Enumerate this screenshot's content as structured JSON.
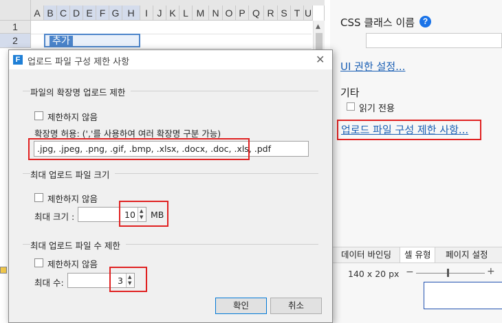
{
  "sheet": {
    "columns": [
      "A",
      "B",
      "C",
      "D",
      "E",
      "F",
      "G",
      "H",
      "I",
      "J",
      "K",
      "L",
      "M",
      "N",
      "O",
      "P",
      "Q",
      "R",
      "S",
      "T",
      "U"
    ],
    "rows": [
      "1",
      "2"
    ],
    "cell_text": "추가"
  },
  "panel": {
    "css_class_label": "CSS 클래스 이름",
    "help_icon": "?",
    "ui_permission_link": "UI 권한 설정...",
    "etc_label": "기타",
    "readonly_label": "읽기 전용",
    "upload_restriction_link": "업로드 파일 구성 제한 사항...",
    "tabs": [
      "데이터 바인딩",
      "셀 유형",
      "페이지 설정"
    ],
    "active_tab": "셀 유형",
    "size_text": "140 x 20 px",
    "zoom_minus": "−",
    "zoom_plus": "+"
  },
  "dialog": {
    "title": "업로드 파일 구성 제한 사항",
    "app_icon": "F",
    "close": "✕",
    "ext_section": {
      "title": "파일의 확장명 업로드 제한",
      "no_limit_label": "제한하지 않음",
      "allowed_label": "확장명 허용: (','를 사용하여 여러 확장명 구분 가능)",
      "allowed_value": ".jpg, .jpeg, .png, .gif, .bmp, .xlsx, .docx, .doc, .xls, .pdf"
    },
    "size_section": {
      "title": "최대 업로드 파일 크기",
      "no_limit_label": "제한하지 않음",
      "max_label": "최대 크기 :",
      "max_value": "10",
      "unit": "MB"
    },
    "count_section": {
      "title": "최대 업로드 파일 수 제한",
      "no_limit_label": "제한하지 않음",
      "max_label": "최대 수:",
      "max_value": "3"
    },
    "ok_button": "확인",
    "cancel_button": "취소"
  }
}
